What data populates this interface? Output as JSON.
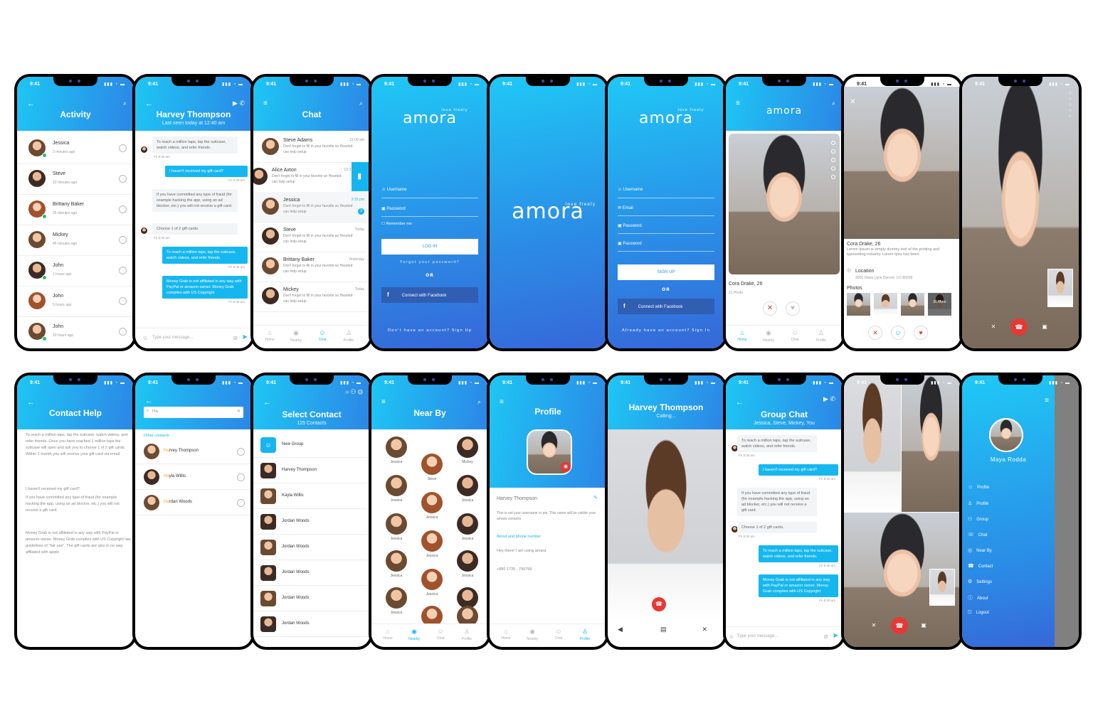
{
  "status_time": "9:41",
  "activity": {
    "title": "Activity",
    "rows": [
      {
        "name": "Jessica",
        "time": "2 minutes ago"
      },
      {
        "name": "Steve",
        "time": "10 minutes ago"
      },
      {
        "name": "Brittany Baker",
        "time": "25 minutes ago"
      },
      {
        "name": "Mickey",
        "time": "45 minutes ago"
      },
      {
        "name": "John",
        "time": "1 hours ago"
      },
      {
        "name": "John",
        "time": "5 hours ago"
      },
      {
        "name": "John",
        "time": "10 hours ago"
      }
    ]
  },
  "chat_harvey": {
    "title": "Harvey Thompson",
    "subtitle": "Last seen today at 12:40 am",
    "messages": [
      {
        "dir": "in",
        "text": "To reach a million taps, tap the suitcase, watch videos, and refer friends.",
        "meta": "Fri 8:30 am"
      },
      {
        "dir": "out",
        "text": "I haven't received my gift card?",
        "meta": "Fri 8:30 am"
      },
      {
        "dir": "in",
        "text": "If you have committed any type of fraud (for example hacking the app, using an ad blocker, etc.) you will not receive a gift card.",
        "meta": ""
      },
      {
        "dir": "in",
        "text": "Choose 1 of 2 gift cards.",
        "meta": "Fri 8:30 am"
      },
      {
        "dir": "out",
        "text": "To reach a million taps, tap the suitcase, watch videos, and refer friends.",
        "meta": "Fri 8:30 am"
      },
      {
        "dir": "out",
        "text": "Money Grab is not affiliated in any way with PayPal or amazon owner. Money Grab complies with US Copyright",
        "meta": "Fri 8:30 am"
      }
    ],
    "input_placeholder": "Type your message..."
  },
  "chat_list": {
    "title": "Chat",
    "rows": [
      {
        "name": "Steve Adams",
        "time": "11:00 am",
        "msg": "Don't forget to fill in your favorite so Hearted can help setup"
      },
      {
        "name": "Alice Axton",
        "time": "10:32",
        "msg": "Don't forget to fill in your favorite so Hearted can help setup"
      },
      {
        "name": "Jessica",
        "time": "2:15 pm",
        "msg": "Don't forget to fill in your favorite so Hearted can help setup"
      },
      {
        "name": "Steve",
        "time": "Today",
        "msg": "Don't forget to fill in your favorite so Hearted can help setup"
      },
      {
        "name": "Brittany Baker",
        "time": "Yesterday",
        "msg": "Don't forget to fill in your favorite so Hearted can help setup"
      },
      {
        "name": "Mickey",
        "time": "Today",
        "msg": "Don't forget to fill in your favorite so Hearted can help setup"
      }
    ],
    "unread": "2",
    "tabs": [
      "Home",
      "Nearby",
      "Chat",
      "Profile"
    ]
  },
  "login": {
    "logo": "amora",
    "tagline": "love freely",
    "username": "Username",
    "password": "Password",
    "remember": "Remember me",
    "login_btn": "LOG IN",
    "forgot": "Forgot your password?",
    "or": "OR",
    "facebook": "Connect with Facebook",
    "signup_link": "Don't have an account? Sign Up"
  },
  "splash": {
    "logo": "amora",
    "tagline": "love freely"
  },
  "signup": {
    "username": "Username",
    "email": "Email",
    "password": "Password",
    "password2": "Password",
    "btn": "SIGN UP",
    "or": "OR",
    "facebook": "Connect with Facebook",
    "signin_link": "Already have an account? Sign In"
  },
  "discover": {
    "name": "Cora Drake, 26",
    "photos": "21 Photo",
    "tabs": [
      "Home",
      "Nearby",
      "Chat",
      "Profile"
    ]
  },
  "profile_detail": {
    "name": "Cora Drake, 26",
    "desc": "Lorem Ipsum is simply dummy text of the printing and typesetting industry. Lorem Ipsu has been",
    "location_label": "Location",
    "location": "3000 Davis Lane Denver, CO 80239",
    "photos_label": "Photos",
    "more": "26 More"
  },
  "contact_help": {
    "title": "Contact Help",
    "para1": "To reach a million taps, tap the suitcase, watch videos, and refer friends. Once you have reached 1 million taps the suitcase will open and ask you to choose 1 of 2 gift cards. Within 1 month you will receive your gift card via email.",
    "para2": "I haven't received my gift card?",
    "para3": "If you have committed any type of fraud (for example hacking the app, using an ad blocker, etc.) you will not receive a gift card.",
    "para4": "Money Grab is not affiliated in any way with PayPal or amazon owner. Money Grab complies with US Copyright law guidelines of \"fair use\". The gift cards are also in no way affiliated with apple."
  },
  "search": {
    "query": "Ha",
    "section": "Other contacts",
    "rows": [
      {
        "hl": "Ha",
        "rest": "rvey Thompson"
      },
      {
        "hl": "Ha",
        "rest": "yla Willis"
      },
      {
        "hl": "Ha",
        "rest": "rdan Woods"
      }
    ]
  },
  "select_contact": {
    "title": "Select Contact",
    "sub": "125 Contacts",
    "rows": [
      "New Group",
      "Harvey Thompson",
      "Kayla Willis",
      "Jordan Woods",
      "Jordan Woods",
      "Jordan Woods",
      "Jordan Woods",
      "Jordan Woods"
    ]
  },
  "nearby": {
    "title": "Near By",
    "people": [
      "Jessica",
      "Mickey",
      "Steve",
      "Jessica",
      "Jessica",
      "Jessica",
      "Jessica",
      "Jessica",
      "Jessica",
      "Jessica",
      "Jessica",
      "Jessica",
      "Jessica",
      "Jessica",
      "Jessica",
      "Jessica"
    ],
    "tabs": [
      "Home",
      "Nearby",
      "Chat",
      "Profile"
    ]
  },
  "profile": {
    "title": "Profile",
    "name": "Harvey Thompson",
    "hint": "This is not your username or pin. This name will be visible your amara contacts.",
    "section": "About and phone number",
    "about": "Hey there! I am using amara",
    "phone": "+880 1735 - 799799",
    "tabs": [
      "Home",
      "Nearby",
      "Chat",
      "Profile"
    ]
  },
  "calling": {
    "name": "Harvey Thompson",
    "status": "Calling..."
  },
  "group_chat": {
    "title": "Group Chat",
    "sub": "Jessica, Steve, Mickey, You",
    "messages": [
      {
        "dir": "in",
        "text": "To reach a million taps, tap the suitcase, watch videos, and refer friends.",
        "meta": "Fri 8:30 am"
      },
      {
        "dir": "out",
        "text": "I haven't received my gift card?",
        "meta": "Fri 8:30 am"
      },
      {
        "dir": "in",
        "text": "If you have committed any type of fraud (for example hacking the app, using an ad blocker, etc.) you will not receive a gift card.",
        "meta": ""
      },
      {
        "dir": "in",
        "text": "Choose 1 of 2 gift cards.",
        "meta": "Fri 8:30 am"
      },
      {
        "dir": "out",
        "text": "To reach a million taps, tap the suitcase, watch videos, and refer friends.",
        "meta": "Fri 8:30 am"
      },
      {
        "dir": "out",
        "text": "Money Grab is not affiliated in any way with PayPal or amazon owner. Money Grab complies with US Copyright",
        "meta": "Fri 8:30 am"
      }
    ],
    "input_placeholder": "Type your message..."
  },
  "menu": {
    "name": "Maya Rodda",
    "items": [
      "Profile",
      "Profile",
      "Group",
      "Chat",
      "Near By",
      "Contact",
      "Settings",
      "About",
      "Logout"
    ]
  },
  "colors": {
    "accent": "#17b5ef",
    "grad_start": "#1ec6f4",
    "grad_end": "#2c86e6",
    "decline": "#e53935"
  }
}
